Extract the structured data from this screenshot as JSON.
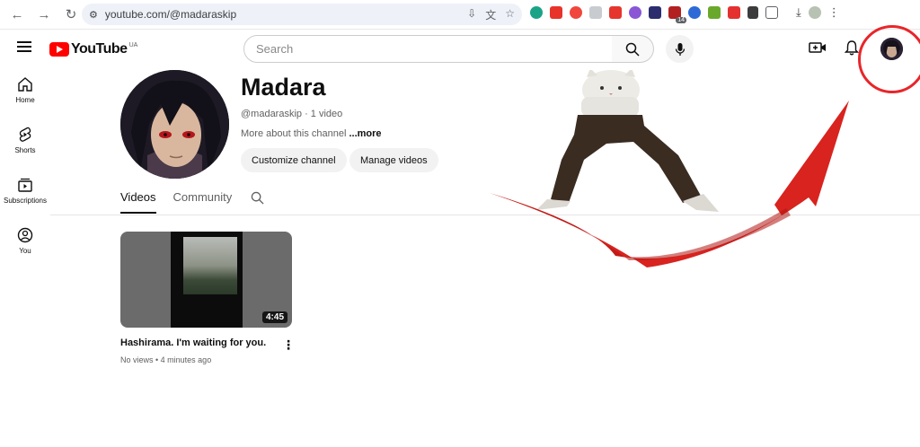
{
  "browser": {
    "url": "youtube.com/@madaraskip",
    "extension_badge": "14"
  },
  "masthead": {
    "logo_text": "YouTube",
    "logo_country": "UA",
    "search_placeholder": "Search"
  },
  "guide": {
    "items": [
      {
        "label": "Home",
        "icon": "home-icon"
      },
      {
        "label": "Shorts",
        "icon": "shorts-icon"
      },
      {
        "label": "Subscriptions",
        "icon": "subscriptions-icon"
      },
      {
        "label": "You",
        "icon": "you-icon"
      }
    ]
  },
  "channel": {
    "name": "Madara",
    "handle_meta": "@madaraskip · 1 video",
    "about_text": "More about this channel ",
    "about_more": "...more",
    "customize_label": "Customize channel",
    "manage_label": "Manage videos"
  },
  "tabs": [
    {
      "label": "Videos",
      "active": true
    },
    {
      "label": "Community",
      "active": false
    }
  ],
  "video": {
    "title": "Hashirama. I'm waiting for you.",
    "meta": "No views • 4 minutes ago",
    "duration": "4:45"
  },
  "colors": {
    "brand_red": "#ff0000",
    "annotation_red": "#e8262a"
  }
}
